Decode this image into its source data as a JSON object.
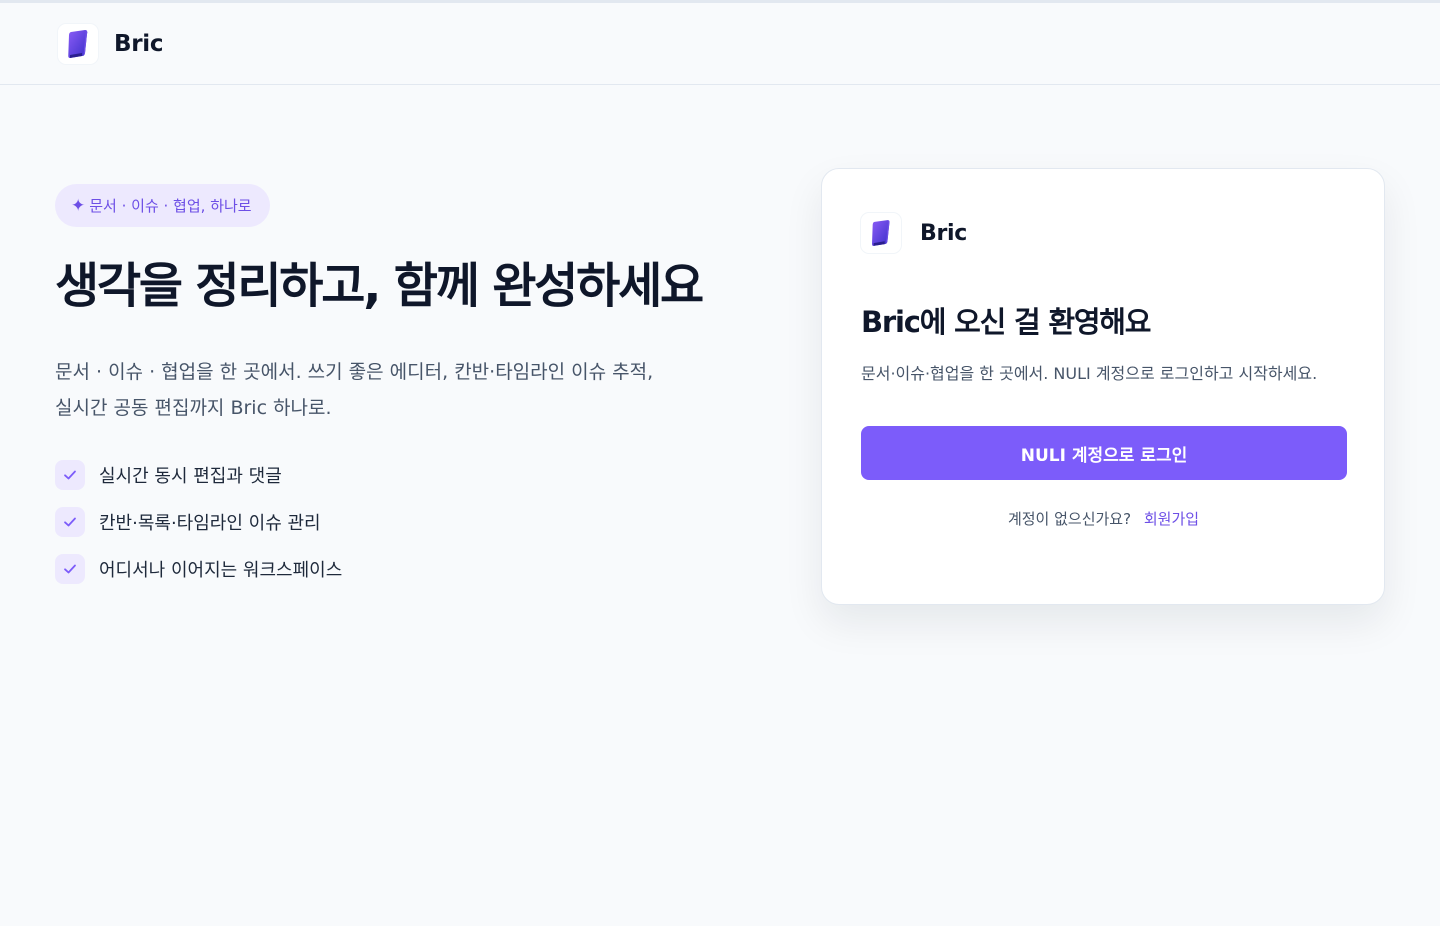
{
  "header": {
    "brand": "Bric",
    "logo_icon": "book-logo-icon"
  },
  "hero": {
    "badge": "문서 · 이슈 · 협업, 하나로",
    "badge_icon": "sparkle-icon",
    "headline": "생각을 정리하고, 함께 완성하세요",
    "lead": "문서 · 이슈 · 협업을 한 곳에서. 쓰기 좋은 에디터, 칸반·타임라인 이슈 추적, 실시간 공동 편집까지 Bric 하나로.",
    "features": [
      {
        "label": "실시간 동시 편집과 댓글"
      },
      {
        "label": "칸반·목록·타임라인 이슈 관리"
      },
      {
        "label": "어디서나 이어지는 워크스페이스"
      }
    ]
  },
  "login_card": {
    "brand": "Bric",
    "title": "Bric에 오신 걸 환영해요",
    "description": "문서·이슈·협업을 한 곳에서. NULI 계정으로 로그인하고 시작하세요.",
    "login_button": "NULI 계정으로 로그인",
    "signup_prompt": "계정이 없으신가요?",
    "signup_link": "회원가입"
  },
  "colors": {
    "accent": "#7c5cfa",
    "accent_text": "#6d4fe6",
    "accent_soft": "#ede9fe",
    "background": "#f8fafc"
  }
}
